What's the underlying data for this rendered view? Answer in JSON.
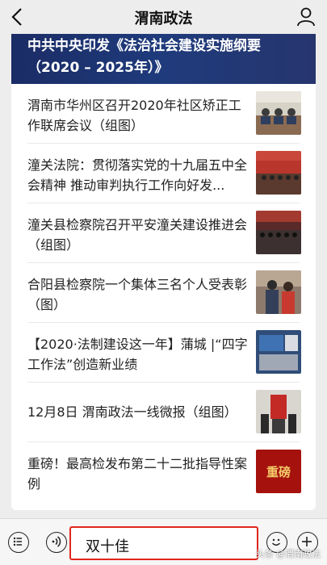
{
  "nav": {
    "title": "渭南政法"
  },
  "hero": {
    "text": "中共中央印发《法治社会建设实施纲要（2020 – 2025年）》"
  },
  "articles": [
    {
      "title": "渭南市华州区召开2020年社区矫正工作联席会议（组图）"
    },
    {
      "title": "潼关法院：贯彻落实党的十九届五中全会精神 推动审判执行工作向好发..."
    },
    {
      "title": "潼关县检察院召开平安潼关建设推进会（组图）"
    },
    {
      "title": "合阳县检察院一个集体三名个人受表彰（图）"
    },
    {
      "title": "【2020·法制建设这一年】蒲城 |“四字工作法”创造新业绩"
    },
    {
      "title": "12月8日 渭南政法一线微报（组图）"
    },
    {
      "title": "重磅！最高检发布第二十二批指导性案例",
      "thumb_text": "重磅"
    }
  ],
  "input": {
    "value": "双十佳"
  },
  "watermark": "头条 @渭南政法",
  "colors": {
    "hero_bg": "#1f3b7c",
    "input_border": "#e0271d",
    "page_bg": "#ededed"
  }
}
